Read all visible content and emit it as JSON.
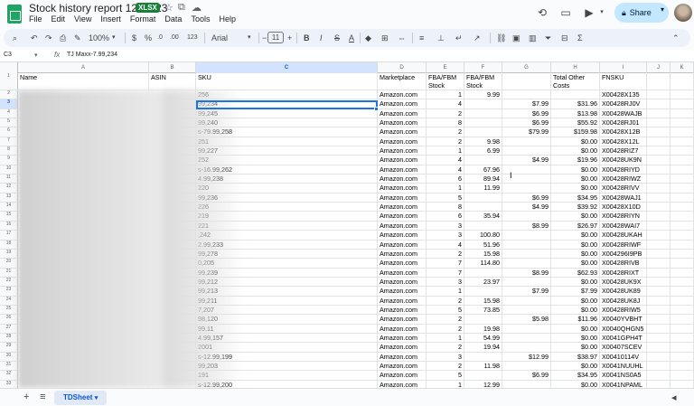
{
  "app": {
    "title": "Stock history report 12/31/23",
    "file_badge": "XLSX",
    "menus": [
      "File",
      "Edit",
      "View",
      "Insert",
      "Format",
      "Data",
      "Tools",
      "Help"
    ],
    "share_label": "Share"
  },
  "toolbar": {
    "zoom": "100%",
    "currency": "$",
    "percent": "%",
    "decrease_decimal": ".0",
    "increase_decimal": ".00",
    "number_format": "123",
    "font": "Arial",
    "font_size": "11",
    "minus": "−",
    "plus": "+",
    "bold": "B",
    "italic": "I",
    "strike": "S",
    "text_color": "A"
  },
  "formula_bar": {
    "cell_ref": "C3",
    "fx": "fx",
    "content": "TJ Maxx-7.99,234"
  },
  "grid": {
    "columns": [
      "A",
      "B",
      "C",
      "D",
      "E",
      "F",
      "G",
      "H",
      "I",
      "J",
      "K"
    ],
    "active_column": "C",
    "active_row": "3",
    "header_row": {
      "num": "1",
      "cells": [
        "Name",
        "ASIN",
        "SKU",
        "Marketplace",
        "FBA/FBM Stock",
        "FBA/FBM Stock value",
        "",
        "Total Other Costs",
        "FNSKU",
        "",
        ""
      ]
    },
    "rows": [
      {
        "num": "2",
        "sku": "256",
        "marketplace": "Amazon.com",
        "stock": "1",
        "value": "9.99",
        "g": "",
        "costs": "",
        "fnsku": "X00428X135"
      },
      {
        "num": "3",
        "sku": "99,234",
        "marketplace": "Amazon.com",
        "stock": "4",
        "value": "",
        "g": "$7.99",
        "costs": "$31.96",
        "fnsku": "X00428RJ0V"
      },
      {
        "num": "4",
        "sku": "99,245",
        "marketplace": "Amazon.com",
        "stock": "2",
        "value": "",
        "g": "$6.99",
        "costs": "$13.98",
        "fnsku": "X00428WAJB"
      },
      {
        "num": "5",
        "sku": "99,240",
        "marketplace": "Amazon.com",
        "stock": "8",
        "value": "",
        "g": "$6.99",
        "costs": "$55.92",
        "fnsku": "X00428RJ01"
      },
      {
        "num": "6",
        "sku": "s-79.99,258",
        "marketplace": "Amazon.com",
        "stock": "2",
        "value": "",
        "g": "$79.99",
        "costs": "$159.98",
        "fnsku": "X00428X12B"
      },
      {
        "num": "7",
        "sku": "251",
        "marketplace": "Amazon.com",
        "stock": "2",
        "value": "9.98",
        "g": "",
        "costs": "$0.00",
        "fnsku": "X00428X12L"
      },
      {
        "num": "8",
        "sku": "99,227",
        "marketplace": "Amazon.com",
        "stock": "1",
        "value": "6.99",
        "g": "",
        "costs": "$0.00",
        "fnsku": "X00428RIZ7"
      },
      {
        "num": "9",
        "sku": "252",
        "marketplace": "Amazon.com",
        "stock": "4",
        "value": "",
        "g": "$4.99",
        "costs": "$19.96",
        "fnsku": "X00428UK9N"
      },
      {
        "num": "10",
        "sku": "s-16.99,262",
        "marketplace": "Amazon.com",
        "stock": "4",
        "value": "67.96",
        "g": "",
        "costs": "$0.00",
        "fnsku": "X00428RIYD"
      },
      {
        "num": "11",
        "sku": "4.99,238",
        "marketplace": "Amazon.com",
        "stock": "6",
        "value": "89.94",
        "g": "",
        "costs": "$0.00",
        "fnsku": "X00428RIWZ"
      },
      {
        "num": "12",
        "sku": "220",
        "marketplace": "Amazon.com",
        "stock": "1",
        "value": "11.99",
        "g": "",
        "costs": "$0.00",
        "fnsku": "X00428RIVV"
      },
      {
        "num": "13",
        "sku": "99,236",
        "marketplace": "Amazon.com",
        "stock": "5",
        "value": "",
        "g": "$6.99",
        "costs": "$34.95",
        "fnsku": "X00428WAJ1"
      },
      {
        "num": "14",
        "sku": "226",
        "marketplace": "Amazon.com",
        "stock": "8",
        "value": "",
        "g": "$4.99",
        "costs": "$39.92",
        "fnsku": "X00428X10D"
      },
      {
        "num": "15",
        "sku": "219",
        "marketplace": "Amazon.com",
        "stock": "6",
        "value": "35.94",
        "g": "",
        "costs": "$0.00",
        "fnsku": "X00428RIYN"
      },
      {
        "num": "16",
        "sku": "221",
        "marketplace": "Amazon.com",
        "stock": "3",
        "value": "",
        "g": "$8.99",
        "costs": "$26.97",
        "fnsku": "X00428WAI7"
      },
      {
        "num": "17",
        "sku": ",242",
        "marketplace": "Amazon.com",
        "stock": "3",
        "value": "100.80",
        "g": "",
        "costs": "$0.00",
        "fnsku": "X00428UKAH"
      },
      {
        "num": "18",
        "sku": "2.99,233",
        "marketplace": "Amazon.com",
        "stock": "4",
        "value": "51.96",
        "g": "",
        "costs": "$0.00",
        "fnsku": "X00428RIWF"
      },
      {
        "num": "19",
        "sku": "99,278",
        "marketplace": "Amazon.com",
        "stock": "2",
        "value": "15.98",
        "g": "",
        "costs": "$0.00",
        "fnsku": "X004296I9PB"
      },
      {
        "num": "20",
        "sku": "0,205",
        "marketplace": "Amazon.com",
        "stock": "7",
        "value": "114.80",
        "g": "",
        "costs": "$0.00",
        "fnsku": "X00428RIVB"
      },
      {
        "num": "21",
        "sku": "99,239",
        "marketplace": "Amazon.com",
        "stock": "7",
        "value": "",
        "g": "$8.99",
        "costs": "$62.93",
        "fnsku": "X00428RIXT"
      },
      {
        "num": "22",
        "sku": "99,212",
        "marketplace": "Amazon.com",
        "stock": "3",
        "value": "23.97",
        "g": "",
        "costs": "$0.00",
        "fnsku": "X00428UK9X"
      },
      {
        "num": "23",
        "sku": "99,213",
        "marketplace": "Amazon.com",
        "stock": "1",
        "value": "",
        "g": "$7.99",
        "costs": "$7.99",
        "fnsku": "X00428UK89"
      },
      {
        "num": "24",
        "sku": "99,211",
        "marketplace": "Amazon.com",
        "stock": "2",
        "value": "15.98",
        "g": "",
        "costs": "$0.00",
        "fnsku": "X00428UK8J"
      },
      {
        "num": "25",
        "sku": "7,207",
        "marketplace": "Amazon.com",
        "stock": "5",
        "value": "73.85",
        "g": "",
        "costs": "$0.00",
        "fnsku": "X00428RIW5"
      },
      {
        "num": "26",
        "sku": "98,120",
        "marketplace": "Amazon.com",
        "stock": "2",
        "value": "",
        "g": "$5.98",
        "costs": "$11.96",
        "fnsku": "X0040YVBHT"
      },
      {
        "num": "27",
        "sku": "99,11",
        "marketplace": "Amazon.com",
        "stock": "2",
        "value": "19.98",
        "g": "",
        "costs": "$0.00",
        "fnsku": "X0040QHGN5"
      },
      {
        "num": "28",
        "sku": "4.99,157",
        "marketplace": "Amazon.com",
        "stock": "1",
        "value": "54.99",
        "g": "",
        "costs": "$0.00",
        "fnsku": "X0041GPH4T"
      },
      {
        "num": "29",
        "sku": "2001",
        "marketplace": "Amazon.com",
        "stock": "2",
        "value": "19.94",
        "g": "",
        "costs": "$0.00",
        "fnsku": "X00407SCEV"
      },
      {
        "num": "30",
        "sku": "s-12.99,199",
        "marketplace": "Amazon.com",
        "stock": "3",
        "value": "",
        "g": "$12.99",
        "costs": "$38.97",
        "fnsku": "X00410114V"
      },
      {
        "num": "31",
        "sku": "99,203",
        "marketplace": "Amazon.com",
        "stock": "2",
        "value": "11.98",
        "g": "",
        "costs": "$0.00",
        "fnsku": "X0041NUUHL"
      },
      {
        "num": "32",
        "sku": "191",
        "marketplace": "Amazon.com",
        "stock": "5",
        "value": "",
        "g": "$6.99",
        "costs": "$34.95",
        "fnsku": "X0041NS0A5"
      },
      {
        "num": "33",
        "sku": "s-12.99,200",
        "marketplace": "Amazon.com",
        "stock": "1",
        "value": "12.99",
        "g": "",
        "costs": "$0.00",
        "fnsku": "X0041NPAML"
      }
    ]
  },
  "sheets": {
    "tabs": [
      {
        "label": "TDSheet",
        "active": true
      }
    ]
  },
  "colors": {
    "accent": "#0b57d0",
    "sheets_green": "#1fa463",
    "share_bg": "#c2e7ff",
    "selection": "#1a73e8"
  }
}
